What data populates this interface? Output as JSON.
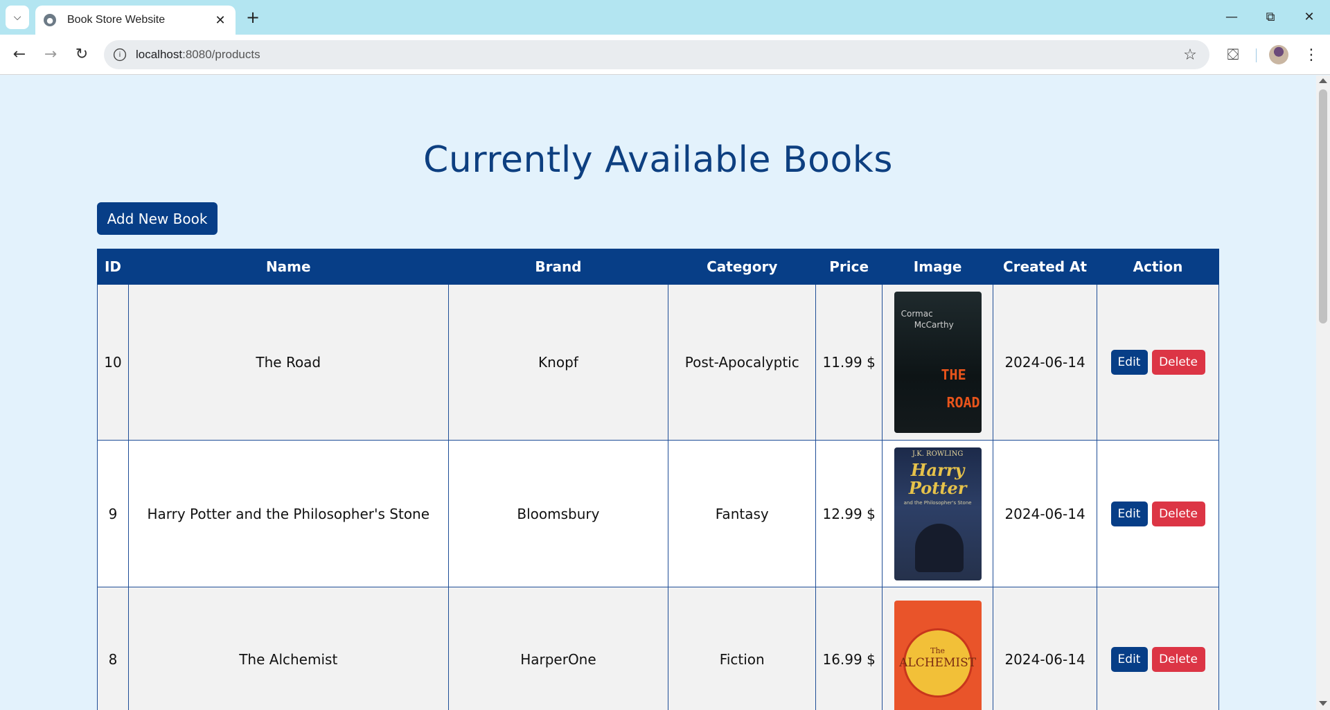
{
  "browser": {
    "tab_title": "Book Store Website",
    "url_host": "localhost",
    "url_path": ":8080/products"
  },
  "page": {
    "title": "Currently Available Books",
    "add_button": "Add New Book"
  },
  "table": {
    "headers": [
      "ID",
      "Name",
      "Brand",
      "Category",
      "Price",
      "Image",
      "Created At",
      "Action"
    ],
    "rows": [
      {
        "id": "10",
        "name": "The Road",
        "brand": "Knopf",
        "category": "Post-Apocalyptic",
        "price": "11.99 $",
        "created_at": "2024-06-14",
        "edit": "Edit",
        "delete": "Delete",
        "cover": {
          "author_line1": "Cormac",
          "author_line2": "McCarthy",
          "title_line1": "THE",
          "title_line2": "ROAD"
        }
      },
      {
        "id": "9",
        "name": "Harry Potter and the Philosopher's Stone",
        "brand": "Bloomsbury",
        "category": "Fantasy",
        "price": "12.99 $",
        "created_at": "2024-06-14",
        "edit": "Edit",
        "delete": "Delete",
        "cover": {
          "author": "J.K. ROWLING",
          "title_line1": "Harry",
          "title_line2": "Potter",
          "subtitle": "and the Philosopher's Stone"
        }
      },
      {
        "id": "8",
        "name": "The Alchemist",
        "brand": "HarperOne",
        "category": "Fiction",
        "price": "16.99 $",
        "created_at": "2024-06-14",
        "edit": "Edit",
        "delete": "Delete",
        "cover": {
          "the": "The",
          "title": "ALCHEMIST"
        }
      }
    ]
  },
  "colors": {
    "primary": "#073e87",
    "danger": "#dc3545",
    "page_bg": "#e3f2fc"
  }
}
